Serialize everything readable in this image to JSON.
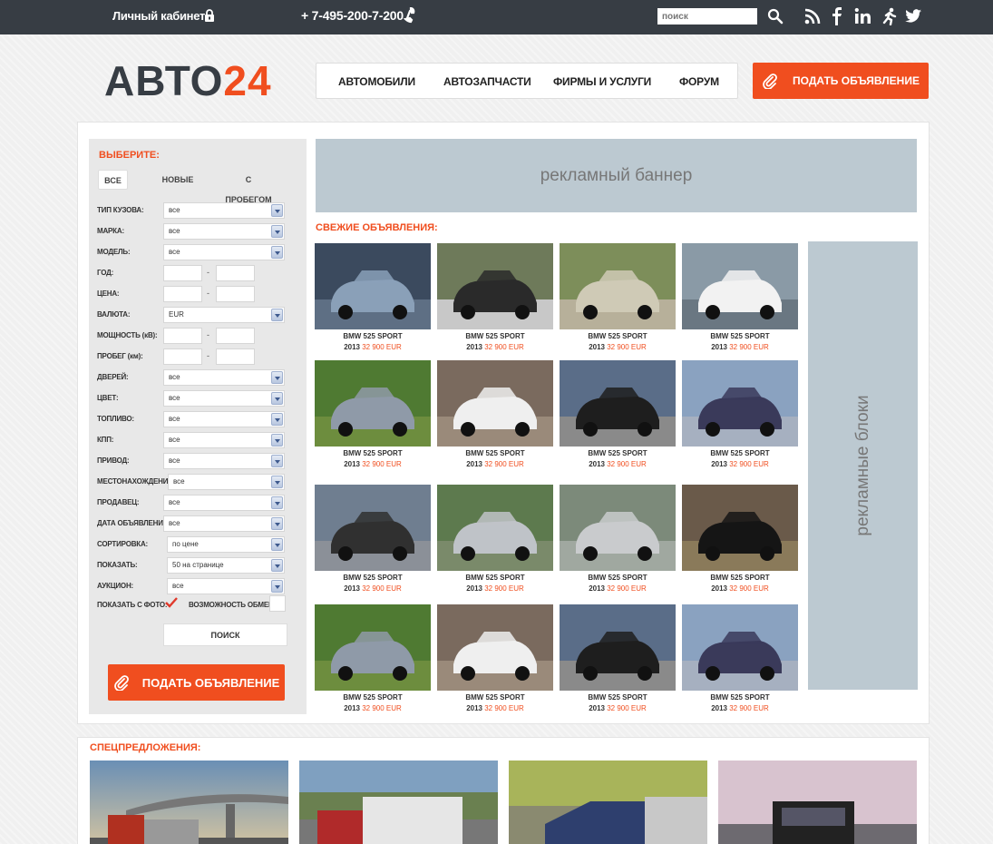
{
  "topbar": {
    "cabinet": "Личный кабинет",
    "phone": "+ 7-495-200-7-200",
    "search_placeholder": "поиск"
  },
  "logo": {
    "part1": "АВТО",
    "part2": "24"
  },
  "nav": [
    "АВТОМОБИЛИ",
    "АВТОЗАПЧАСТИ",
    "ФИРМЫ И УСЛУГИ",
    "ФОРУМ"
  ],
  "post_button": "ПОДАТЬ ОБЪЯВЛЕНИЕ",
  "filter": {
    "title": "ВЫБЕРИТЕ:",
    "tabs": [
      "ВСЕ",
      "НОВЫЕ",
      "С ПРОБЕГОМ"
    ],
    "labels": {
      "body": "ТИП КУЗОВА:",
      "make": "МАРКА:",
      "model": "МОДЕЛЬ:",
      "year": "ГОД:",
      "price": "ЦЕНА:",
      "currency": "ВАЛЮТА:",
      "power": "МОЩНОСТЬ (кВ):",
      "mileage": "ПРОБЕГ (км):",
      "doors": "ДВЕРЕЙ:",
      "color": "ЦВЕТ:",
      "fuel": "ТОПЛИВО:",
      "gearbox": "КПП:",
      "drive": "ПРИВОД:",
      "location": "МЕСТОНАХОЖДЕНИЕ:",
      "seller": "ПРОДАВЕЦ:",
      "date": "ДАТА ОБЪЯВЛЕНИЯ:",
      "sort": "СОРТИРОВКА:",
      "show": "ПОКАЗАТЬ:",
      "auction": "АУКЦИОН:",
      "with_photo": "ПОКАЗАТЬ С ФОТО:",
      "exchange": "ВОЗМОЖНОСТЬ ОБМЕНА:"
    },
    "values": {
      "all": "все",
      "currency": "EUR",
      "sort": "по цене",
      "show": "50 на странице"
    },
    "dash": "-",
    "search_button": "ПОИСК",
    "post_button": "ПОДАТЬ ОБЪЯВЛЕНИЕ"
  },
  "banner": "рекламный баннер",
  "fresh_title": "СВЕЖИЕ ОБЪЯВЛЕНИЯ:",
  "ad_blocks": "рекламные блоки",
  "listing": {
    "model": "BMW 525 SPORT",
    "year": "2013",
    "price": "32 900 EUR"
  },
  "special_title": "СПЕЦПРЕДЛОЖЕНИЯ:",
  "colors": {
    "accent": "#f04e1f",
    "dark": "#373d44",
    "ad": "#bcc9d1"
  }
}
